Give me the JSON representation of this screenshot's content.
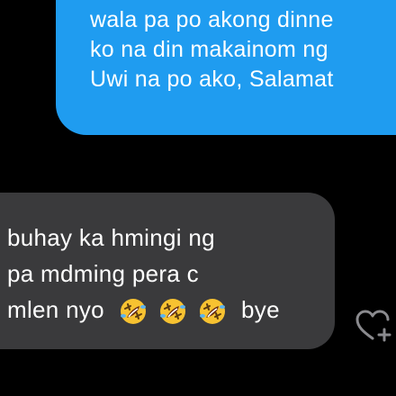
{
  "conversation": {
    "outgoing": {
      "lines": [
        "wala pa po akong dinne",
        "ko na din makainom ng",
        "Uwi na po ako, Salamat"
      ],
      "color": "#1f9cf0"
    },
    "incoming": {
      "lines": [
        "buhay ka hmingi ng",
        "pa mdming pera c",
        "mlen nyo"
      ],
      "emojis": [
        "rolling-on-floor-laughing",
        "rolling-on-floor-laughing",
        "rolling-on-floor-laughing"
      ],
      "suffix": "bye",
      "color": "#3a3a3c"
    },
    "reaction_icon": "add-reaction-heart-icon"
  }
}
